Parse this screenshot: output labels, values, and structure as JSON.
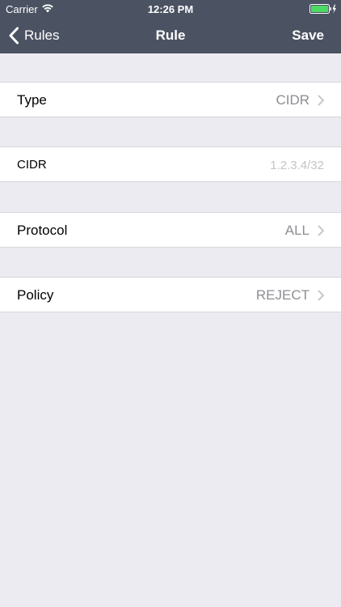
{
  "status_bar": {
    "carrier": "Carrier",
    "time": "12:26 PM",
    "wifi_icon": "wifi-icon",
    "battery_icon": "battery-icon",
    "battery_color": "#4cd964"
  },
  "nav": {
    "back_label": "Rules",
    "title": "Rule",
    "save_label": "Save",
    "bar_color": "#4b5262"
  },
  "rows": {
    "type": {
      "label": "Type",
      "value": "CIDR"
    },
    "cidr": {
      "label": "CIDR",
      "value": "",
      "placeholder": "1.2.3.4/32"
    },
    "protocol": {
      "label": "Protocol",
      "value": "ALL"
    },
    "policy": {
      "label": "Policy",
      "value": "REJECT"
    }
  },
  "colors": {
    "background": "#ebebf1",
    "value_text": "#8e8e93",
    "placeholder_text": "#c4c4c9"
  }
}
